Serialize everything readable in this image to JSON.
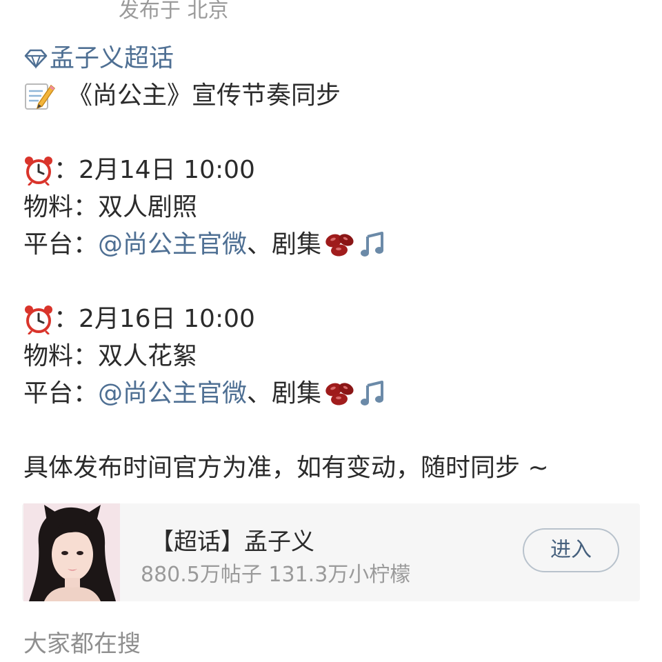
{
  "post": {
    "location": "发布于 北京",
    "topic_link": "孟子义超话",
    "headline": "《尚公主》宣传节奏同步",
    "schedules": [
      {
        "time": "：2月14日 10:00",
        "material_label": "物料：",
        "material_value": "双人剧照",
        "platform_label": "平台：",
        "platform_link": "@尚公主官微",
        "platform_rest": " 、剧集"
      },
      {
        "time": "：2月16日 10:00",
        "material_label": "物料：",
        "material_value": "双人花絮",
        "platform_label": "平台：",
        "platform_link": "@尚公主官微",
        "platform_rest": "、剧集"
      }
    ],
    "footer_note": "具体发布时间官方为准，如有变动，随时同步 ~"
  },
  "topic_card": {
    "title": "【超话】孟子义",
    "stats": "880.5万帖子 131.3万小柠檬",
    "enter_label": "进入"
  },
  "section": {
    "heading": "大家都在搜"
  },
  "icons": {
    "topic": "diamond-icon",
    "headline": "memo-icon",
    "time": "alarm-clock-icon",
    "platform_beans": "red-beans-icon",
    "platform_music": "music-note-icon"
  },
  "colors": {
    "link": "#4e6f93",
    "text": "#2b2b2b",
    "muted": "#9a9a9a",
    "card_background": "#f6f6f6"
  }
}
